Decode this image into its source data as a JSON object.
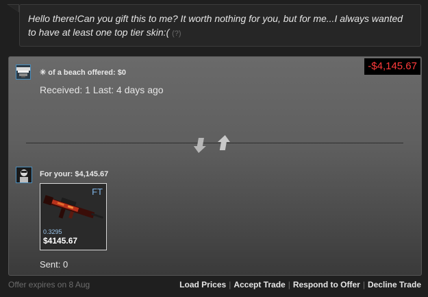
{
  "message": {
    "text": "Hello there!Can you gift this to me? It worth nothing for you, but for me...I always wanted to have at least one top tier skin:(",
    "help": "(?)"
  },
  "offer": {
    "value_badge": "-$4,145.67",
    "offered_label": "of a beach offered: $0",
    "offered_icon": "snowflake-icon",
    "received": "Received: 1 Last: 4 days ago",
    "for_your": "For your: $4,145.67",
    "item": {
      "wear": "FT",
      "float": "0.3295",
      "price": "$4145.67"
    },
    "sent": "Sent: 0"
  },
  "footer": {
    "expires": "Offer expires on 8 Aug",
    "actions": [
      "Load Prices",
      "Accept Trade",
      "Respond to Offer",
      "Decline Trade"
    ]
  },
  "colors": {
    "badge_text": "#ff3b3b",
    "wear_text": "#7fb4e6",
    "avatar_border": "#4a8fbf"
  }
}
